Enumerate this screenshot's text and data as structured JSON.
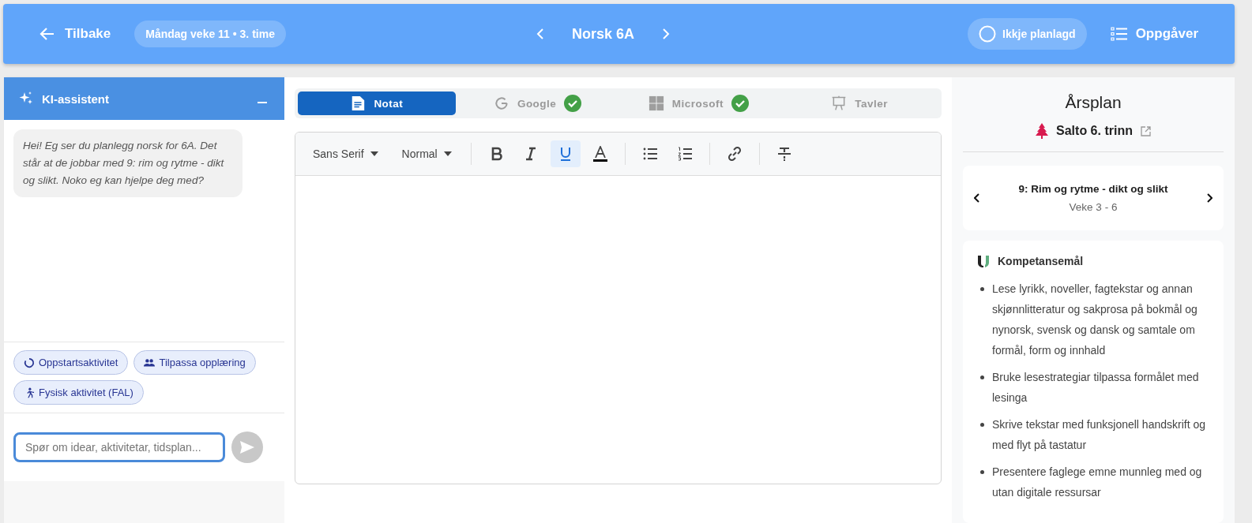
{
  "header": {
    "back": "Tilbake",
    "lesson": "Måndag veke 11 • 3. time",
    "class_title": "Norsk 6A",
    "status": "Ikkje planlagd",
    "tasks": "Oppgåver"
  },
  "assistant": {
    "title": "KI-assistent",
    "message": "Hei! Eg ser du planlegg norsk for 6A. Det står at de jobbar med 9: rim og rytme - dikt og slikt. Noko eg kan hjelpe deg med?",
    "chips": [
      {
        "label": "Oppstartsaktivitet",
        "kind": "startup"
      },
      {
        "label": "Tilpassa opplæring",
        "kind": "people"
      },
      {
        "label": "Fysisk aktivitet (FAL)",
        "kind": "run"
      }
    ],
    "input": {
      "placeholder": "Spør om idear, aktivitetar, tidsplan..."
    }
  },
  "tabs": [
    {
      "label": "Notat",
      "kind": "note",
      "selected": true,
      "synced": false
    },
    {
      "label": "Google",
      "kind": "google",
      "selected": false,
      "synced": true
    },
    {
      "label": "Microsoft",
      "kind": "microsoft",
      "selected": false,
      "synced": true
    },
    {
      "label": "Tavler",
      "kind": "board",
      "selected": false,
      "synced": false
    }
  ],
  "editor": {
    "font": "Sans Serif",
    "size": "Normal",
    "tools": [
      {
        "kind": "bold",
        "on": false
      },
      {
        "kind": "italic",
        "on": false
      },
      {
        "kind": "underline",
        "on": true
      },
      {
        "kind": "color",
        "on": false
      },
      {
        "kind": "bullet-list",
        "on": false
      },
      {
        "kind": "ordered-list",
        "on": false
      },
      {
        "kind": "link",
        "on": false
      },
      {
        "kind": "clear-format",
        "on": false
      }
    ]
  },
  "year_plan": {
    "title": "Årsplan",
    "plan": "Salto 6. trinn",
    "topic": "9: Rim og rytme - dikt og slikt",
    "weeks": "Veke 3 - 6",
    "goals_title": "Kompetansemål",
    "goals": [
      "Lese lyrikk, noveller, fagtekstar og annan skjønnlitteratur og sakprosa på bokmål og nynorsk, svensk og dansk og samtale om formål, form og innhald",
      "Bruke lesestrategiar tilpassa formålet med lesinga",
      "Skrive tekstar med funksjonell handskrift og med flyt på tastatur",
      "Presentere faglege emne munnleg med og utan digitale ressursar"
    ]
  }
}
